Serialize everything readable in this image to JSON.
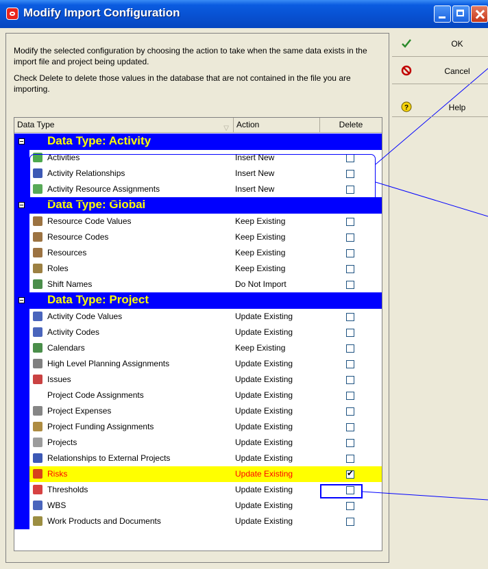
{
  "window": {
    "title": "Modify Import Configuration",
    "controls": {
      "minimize": "minimize",
      "maximize": "maximize",
      "close": "close"
    }
  },
  "description": {
    "line1": "Modify the selected configuration by choosing the action to take when the same data exists in the import file and project being updated.",
    "line2": "Check Delete to delete those values in the database that are not contained in the file you are importing."
  },
  "columns": {
    "type": "Data Type",
    "action": "Action",
    "delete": "Delete"
  },
  "groups": [
    {
      "title": "Data Type: Activity",
      "rows": [
        {
          "icon": "activities-icon",
          "label": "Activities",
          "action": "Insert New",
          "delete": false
        },
        {
          "icon": "activity-relationships-icon",
          "label": "Activity Relationships",
          "action": "Insert New",
          "delete": false
        },
        {
          "icon": "resource-assignments-icon",
          "label": "Activity Resource Assignments",
          "action": "Insert New",
          "delete": false
        }
      ]
    },
    {
      "title": "Data Type: Global",
      "rows": [
        {
          "icon": "resource-code-values-icon",
          "label": "Resource Code Values",
          "action": "Keep Existing",
          "delete": false
        },
        {
          "icon": "resource-codes-icon",
          "label": "Resource Codes",
          "action": "Keep Existing",
          "delete": false
        },
        {
          "icon": "resources-icon",
          "label": "Resources",
          "action": "Keep Existing",
          "delete": false
        },
        {
          "icon": "roles-icon",
          "label": "Roles",
          "action": "Keep Existing",
          "delete": false
        },
        {
          "icon": "shift-names-icon",
          "label": "Shift Names",
          "action": "Do Not Import",
          "delete": false
        }
      ]
    },
    {
      "title": "Data Type: Project",
      "rows": [
        {
          "icon": "activity-code-values-icon",
          "label": "Activity Code Values",
          "action": "Update Existing",
          "delete": false
        },
        {
          "icon": "activity-codes-icon",
          "label": "Activity Codes",
          "action": "Update Existing",
          "delete": false
        },
        {
          "icon": "calendars-icon",
          "label": "Calendars",
          "action": "Keep Existing",
          "delete": false
        },
        {
          "icon": "planning-assignments-icon",
          "label": "High Level Planning Assignments",
          "action": "Update Existing",
          "delete": false
        },
        {
          "icon": "issues-icon",
          "label": "Issues",
          "action": "Update Existing",
          "delete": false
        },
        {
          "icon": "",
          "label": "Project Code Assignments",
          "action": "Update Existing",
          "delete": false
        },
        {
          "icon": "project-expenses-icon",
          "label": "Project Expenses",
          "action": "Update Existing",
          "delete": false
        },
        {
          "icon": "funding-assignments-icon",
          "label": "Project Funding Assignments",
          "action": "Update Existing",
          "delete": false
        },
        {
          "icon": "projects-icon",
          "label": "Projects",
          "action": "Update Existing",
          "delete": false
        },
        {
          "icon": "external-relationships-icon",
          "label": "Relationships to External Projects",
          "action": "Update Existing",
          "delete": false
        },
        {
          "icon": "risks-icon",
          "label": "Risks",
          "action": "Update Existing",
          "delete": true,
          "selected": true
        },
        {
          "icon": "thresholds-icon",
          "label": "Thresholds",
          "action": "Update Existing",
          "delete": false
        },
        {
          "icon": "wbs-icon",
          "label": "WBS",
          "action": "Update Existing",
          "delete": false
        },
        {
          "icon": "work-products-icon",
          "label": "Work Products and Documents",
          "action": "Update Existing",
          "delete": false
        }
      ]
    }
  ],
  "buttons": {
    "ok": {
      "label": "OK",
      "icon": "checkmark-icon"
    },
    "cancel": {
      "label": "Cancel",
      "icon": "cancel-icon"
    },
    "help": {
      "label": "Help",
      "icon": "help-icon"
    }
  },
  "colors": {
    "group_bg": "#0000ff",
    "group_text": "#ffff00",
    "selected_row": "#ffff00",
    "selected_text": "#ff0000",
    "title_bar": "#0a5be0"
  }
}
